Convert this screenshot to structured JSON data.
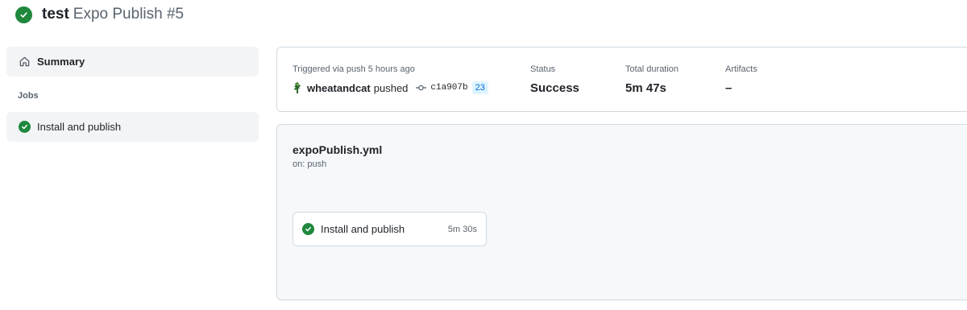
{
  "header": {
    "workflow_name": "test",
    "run_title": "Expo Publish #5"
  },
  "sidebar": {
    "summary_label": "Summary",
    "jobs_heading": "Jobs",
    "jobs": [
      {
        "label": "Install and publish",
        "status": "success"
      }
    ]
  },
  "summary": {
    "trigger_label": "Triggered via push 5 hours ago",
    "actor": "wheatandcat",
    "action": "pushed",
    "commit_sha": "c1a907b",
    "pr_number": "23",
    "status_label": "Status",
    "status_value": "Success",
    "duration_label": "Total duration",
    "duration_value": "5m 47s",
    "artifacts_label": "Artifacts",
    "artifacts_value": "–"
  },
  "workflow": {
    "file_name": "expoPublish.yml",
    "trigger": "on: push",
    "jobs": [
      {
        "name": "Install and publish",
        "duration": "5m 30s",
        "status": "success"
      }
    ]
  },
  "icons": {
    "success": "check-circle-icon",
    "summary": "home-icon",
    "commit": "git-commit-icon",
    "avatar": "user-avatar"
  },
  "colors": {
    "success": "#1f883d",
    "link_badge_bg": "#ddf4ff",
    "link_badge_text": "#0969da",
    "sidebar_selected": "#f3f4f6",
    "workflow_bg": "#f6f8fa"
  }
}
